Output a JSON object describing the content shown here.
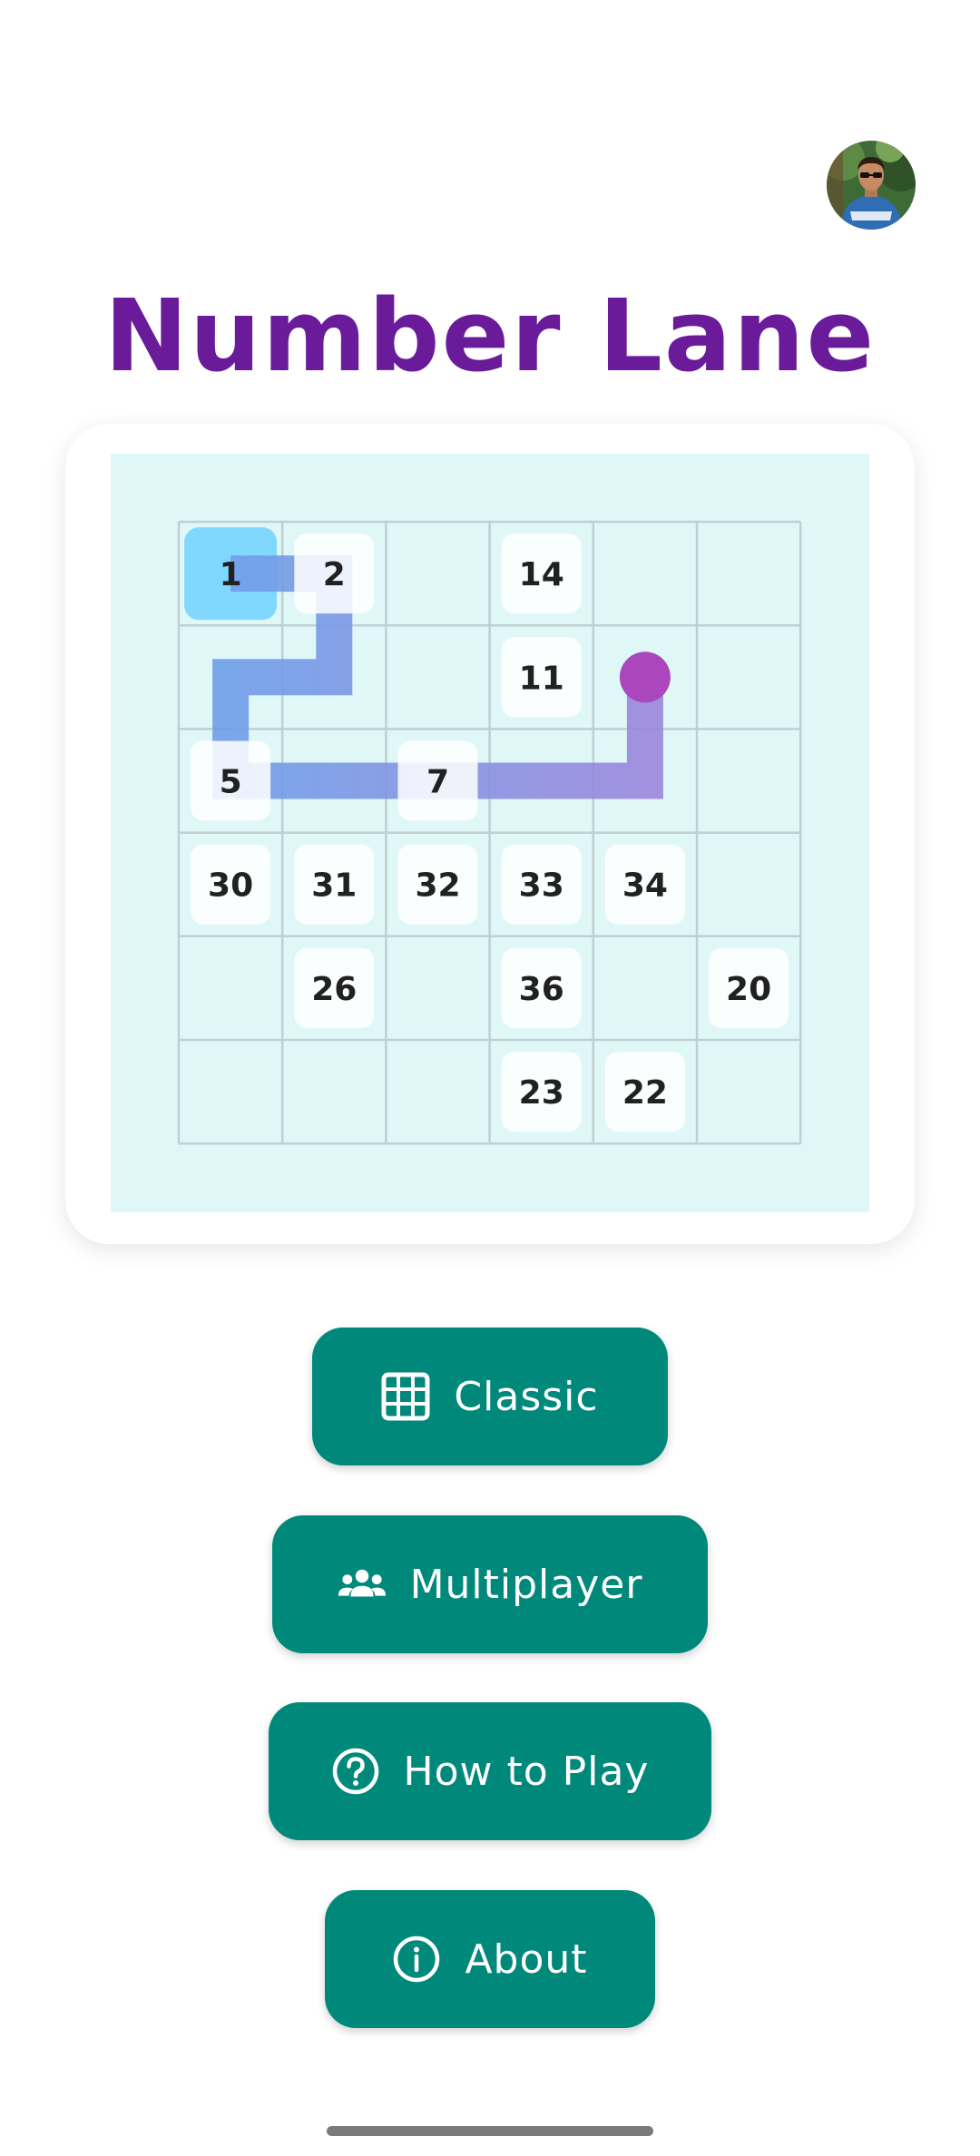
{
  "app": {
    "title": "Number Lane",
    "title_color": "#6a1b9a",
    "accent_color": "#00897b"
  },
  "profile": {
    "avatar_icon": "user-avatar-photo"
  },
  "board": {
    "rows": 6,
    "cols": 6,
    "background_color": "#e0f7f8",
    "tiles": [
      {
        "row": 0,
        "col": 0,
        "label": "1",
        "highlighted": true
      },
      {
        "row": 0,
        "col": 1,
        "label": "2",
        "highlighted": false
      },
      {
        "row": 0,
        "col": 3,
        "label": "14",
        "highlighted": false
      },
      {
        "row": 1,
        "col": 3,
        "label": "11",
        "highlighted": false
      },
      {
        "row": 2,
        "col": 0,
        "label": "5",
        "highlighted": false
      },
      {
        "row": 2,
        "col": 2,
        "label": "7",
        "highlighted": false
      },
      {
        "row": 3,
        "col": 0,
        "label": "30",
        "highlighted": false
      },
      {
        "row": 3,
        "col": 1,
        "label": "31",
        "highlighted": false
      },
      {
        "row": 3,
        "col": 2,
        "label": "32",
        "highlighted": false
      },
      {
        "row": 3,
        "col": 3,
        "label": "33",
        "highlighted": false
      },
      {
        "row": 3,
        "col": 4,
        "label": "34",
        "highlighted": false
      },
      {
        "row": 4,
        "col": 1,
        "label": "26",
        "highlighted": false
      },
      {
        "row": 4,
        "col": 3,
        "label": "36",
        "highlighted": false
      },
      {
        "row": 4,
        "col": 5,
        "label": "20",
        "highlighted": false
      },
      {
        "row": 5,
        "col": 3,
        "label": "23",
        "highlighted": false
      },
      {
        "row": 5,
        "col": 4,
        "label": "22",
        "highlighted": false
      }
    ],
    "path": [
      {
        "row": 0,
        "col": 0
      },
      {
        "row": 0,
        "col": 1
      },
      {
        "row": 1,
        "col": 1
      },
      {
        "row": 1,
        "col": 0
      },
      {
        "row": 2,
        "col": 0
      },
      {
        "row": 2,
        "col": 1
      },
      {
        "row": 2,
        "col": 2
      },
      {
        "row": 2,
        "col": 3
      },
      {
        "row": 2,
        "col": 4
      },
      {
        "row": 1,
        "col": 4
      }
    ],
    "path_head": {
      "row": 1,
      "col": 4
    },
    "path_color_start": "#6f9ee8",
    "path_color_end": "#9a86dc",
    "head_color": "#ab47bc"
  },
  "menu": {
    "classic": {
      "label": "Classic",
      "icon": "grid-icon"
    },
    "multiplayer": {
      "label": "Multiplayer",
      "icon": "group-icon"
    },
    "how_to_play": {
      "label": "How to Play",
      "icon": "help-circle-icon"
    },
    "about": {
      "label": "About",
      "icon": "info-circle-icon"
    }
  }
}
